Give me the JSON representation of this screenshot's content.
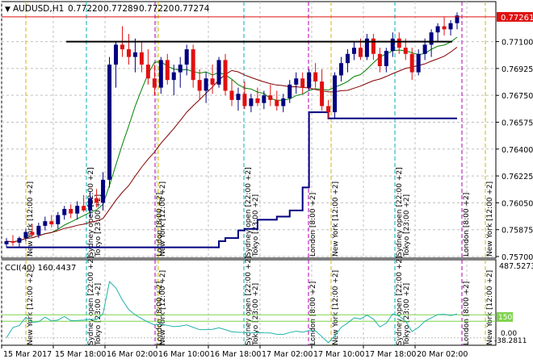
{
  "header": {
    "symbol": "AUDUSD,H1",
    "open": "0.77220",
    "high": "0.77289",
    "low": "0.77220",
    "close": "0.77274"
  },
  "price_axis": {
    "current_price": "0.77261",
    "ticks": [
      "0.77100",
      "0.76925",
      "0.76750",
      "0.76575",
      "0.76400",
      "0.76225",
      "0.76050",
      "0.75875",
      "0.75700"
    ]
  },
  "indicator": {
    "label": "CCI(40) 160.4437",
    "max": "487.5273",
    "level": "150",
    "zero": "0.00",
    "min": "-38.2811"
  },
  "time_axis": {
    "labels": [
      "15 Mar 2017",
      "15 Mar 18:00",
      "16 Mar 02:00",
      "16 Mar 10:00",
      "16 Mar 18:00",
      "17 Mar 02:00",
      "17 Mar 10:00",
      "17 Mar 18:00",
      "20 Mar 02:00"
    ]
  },
  "session_labels": {
    "new_york": "New York  [12:00 +2]",
    "sydney": "Sydney open  [22:00 +2]",
    "tokyo": "Tokyo  [23:00 +2]",
    "london": "London  [8:00 +2]"
  },
  "colors": {
    "background": "#ffffff",
    "bull": "#000080",
    "bear": "#e01010",
    "price_label_bg": "#e01010",
    "ma_dark": "#000080",
    "ma_red": "#800000",
    "ma_green": "#008000",
    "cci_line": "#20b2aa",
    "level_line": "#7fd34f",
    "grid": "#c0c0c0"
  },
  "chart_data": {
    "type": "candlestick",
    "symbol": "AUDUSD",
    "timeframe": "H1",
    "ylim": [
      0.757,
      0.7735
    ],
    "candles": [
      [
        0.7578,
        0.7582,
        0.7576,
        0.758
      ],
      [
        0.758,
        0.7584,
        0.7577,
        0.7579
      ],
      [
        0.7579,
        0.7583,
        0.7576,
        0.7582
      ],
      [
        0.7582,
        0.7588,
        0.758,
        0.7586
      ],
      [
        0.7586,
        0.7591,
        0.7583,
        0.7584
      ],
      [
        0.7584,
        0.7592,
        0.7582,
        0.759
      ],
      [
        0.759,
        0.7596,
        0.7587,
        0.7593
      ],
      [
        0.7593,
        0.7597,
        0.7589,
        0.7591
      ],
      [
        0.7591,
        0.7599,
        0.7588,
        0.7597
      ],
      [
        0.7597,
        0.7603,
        0.7594,
        0.7601
      ],
      [
        0.7601,
        0.7604,
        0.7595,
        0.7598
      ],
      [
        0.7598,
        0.7606,
        0.7594,
        0.7603
      ],
      [
        0.7603,
        0.761,
        0.7599,
        0.76
      ],
      [
        0.76,
        0.7612,
        0.7596,
        0.7608
      ],
      [
        0.7608,
        0.7614,
        0.7602,
        0.7605
      ],
      [
        0.7605,
        0.7625,
        0.76,
        0.762
      ],
      [
        0.762,
        0.77,
        0.7615,
        0.7695
      ],
      [
        0.7695,
        0.771,
        0.768,
        0.7708
      ],
      [
        0.7708,
        0.772,
        0.77,
        0.7705
      ],
      [
        0.7705,
        0.7715,
        0.7695,
        0.77
      ],
      [
        0.77,
        0.7712,
        0.769,
        0.7703
      ],
      [
        0.7703,
        0.771,
        0.769,
        0.7695
      ],
      [
        0.7695,
        0.7705,
        0.7682,
        0.7686
      ],
      [
        0.7686,
        0.7695,
        0.7675,
        0.768
      ],
      [
        0.768,
        0.77,
        0.7676,
        0.7698
      ],
      [
        0.7698,
        0.7702,
        0.7682,
        0.7685
      ],
      [
        0.7685,
        0.7695,
        0.7675,
        0.769
      ],
      [
        0.769,
        0.77,
        0.768,
        0.7695
      ],
      [
        0.7695,
        0.7708,
        0.7688,
        0.7705
      ],
      [
        0.7705,
        0.7708,
        0.768,
        0.7685
      ],
      [
        0.7685,
        0.7692,
        0.7672,
        0.7678
      ],
      [
        0.7678,
        0.769,
        0.767,
        0.7686
      ],
      [
        0.7686,
        0.7695,
        0.7676,
        0.7682
      ],
      [
        0.7682,
        0.77,
        0.768,
        0.7698
      ],
      [
        0.7698,
        0.7702,
        0.7675,
        0.7678
      ],
      [
        0.7678,
        0.7685,
        0.7668,
        0.7672
      ],
      [
        0.7672,
        0.768,
        0.7665,
        0.7676
      ],
      [
        0.7676,
        0.7684,
        0.7666,
        0.7668
      ],
      [
        0.7668,
        0.7676,
        0.7664,
        0.7673
      ],
      [
        0.7673,
        0.768,
        0.7668,
        0.767
      ],
      [
        0.767,
        0.7678,
        0.7666,
        0.7675
      ],
      [
        0.7675,
        0.7682,
        0.7668,
        0.7672
      ],
      [
        0.7672,
        0.7678,
        0.7665,
        0.7668
      ],
      [
        0.7668,
        0.7676,
        0.7664,
        0.7673
      ],
      [
        0.7673,
        0.7685,
        0.767,
        0.7682
      ],
      [
        0.7682,
        0.769,
        0.7676,
        0.7686
      ],
      [
        0.7686,
        0.769,
        0.7676,
        0.768
      ],
      [
        0.768,
        0.7692,
        0.7678,
        0.769
      ],
      [
        0.769,
        0.7696,
        0.768,
        0.7684
      ],
      [
        0.7684,
        0.7692,
        0.7665,
        0.7668
      ],
      [
        0.7668,
        0.7672,
        0.766,
        0.7664
      ],
      [
        0.7664,
        0.769,
        0.766,
        0.7688
      ],
      [
        0.7688,
        0.77,
        0.7684,
        0.7696
      ],
      [
        0.7696,
        0.7705,
        0.769,
        0.7702
      ],
      [
        0.7702,
        0.771,
        0.7698,
        0.7706
      ],
      [
        0.7706,
        0.7712,
        0.7698,
        0.77
      ],
      [
        0.77,
        0.7715,
        0.7698,
        0.7712
      ],
      [
        0.7712,
        0.7715,
        0.7698,
        0.7702
      ],
      [
        0.7702,
        0.7706,
        0.769,
        0.7694
      ],
      [
        0.7694,
        0.7706,
        0.769,
        0.7704
      ],
      [
        0.7704,
        0.7716,
        0.77,
        0.7712
      ],
      [
        0.7712,
        0.7716,
        0.7702,
        0.7706
      ],
      [
        0.7706,
        0.7712,
        0.7698,
        0.7702
      ],
      [
        0.7702,
        0.7706,
        0.7685,
        0.769
      ],
      [
        0.769,
        0.7705,
        0.7688,
        0.7702
      ],
      [
        0.7702,
        0.7712,
        0.7698,
        0.7708
      ],
      [
        0.7708,
        0.7718,
        0.77,
        0.7716
      ],
      [
        0.7716,
        0.7722,
        0.771,
        0.772
      ],
      [
        0.772,
        0.7726,
        0.7714,
        0.7718
      ],
      [
        0.7718,
        0.7724,
        0.7714,
        0.7722
      ],
      [
        0.7722,
        0.7729,
        0.7718,
        0.7727
      ]
    ],
    "session_lines": {
      "new_york": [
        32,
        196,
        410,
        601
      ],
      "sydney_tokyo": [
        107,
        124,
        302,
        316,
        489,
        505
      ],
      "london": [
        192,
        382,
        572
      ]
    },
    "trend_line_level": 0.771
  }
}
